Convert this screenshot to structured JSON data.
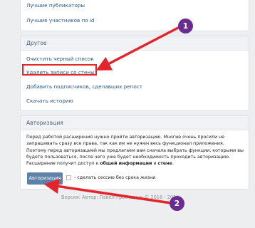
{
  "top_links": [
    "Лучшие публикаторы",
    "Лучшие участников по id"
  ],
  "others": {
    "title": "Другое",
    "items": [
      "Очистить черный список",
      "Удалить записи со стены",
      "Добавить подписчиков, сделавших репост",
      "Скачать историю"
    ]
  },
  "auth": {
    "title": "Авторизация",
    "description": "Перед работой расширения нужно пройти авторизацию. Многие очень просили не запрашивать сразу все права, так как им не нужен весь функционал приложения. Поэтому перед авторизацией мы предлагаем вам сначала выбрать функции, которыми вы будете пользоваться, после чего уже будет необходимость проходить авторизацию.",
    "permissions_prefix": "Расширение получит доступ к ",
    "permissions_bold_1": "общей информации",
    "permissions_and": " и ",
    "permissions_bold_2": "стене",
    "permissions_suffix": ".",
    "button_label": "Авторизация",
    "session_label": "- сделать сессию без срока жизни"
  },
  "footer": "Версия: Автор: Павел Громадчук © 2016 - 2018",
  "annotations": {
    "badge_1": "1",
    "badge_2": "2"
  },
  "colors": {
    "link": "#2a5885",
    "annotation_red": "#e3242b",
    "badge_purple": "#6a2c8e",
    "button": "#5e81a8"
  }
}
